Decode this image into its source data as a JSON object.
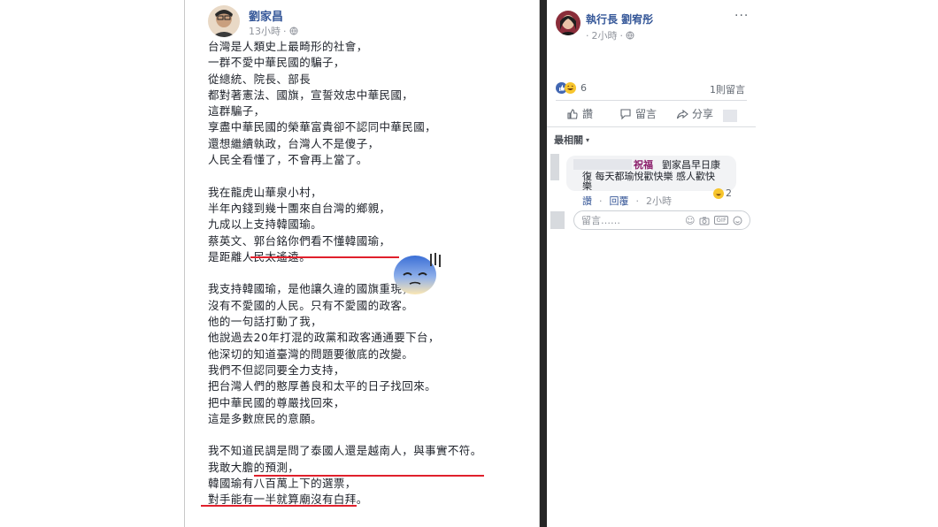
{
  "post": {
    "author": "劉家昌",
    "time": "13小時",
    "paragraphs": [
      [
        "台灣是人類史上最畸形的社會，",
        "一群不愛中華民國的騙子，",
        "從總統、院長、部長",
        "都對著憲法、國旗，宣誓效忠中華民國，",
        "這群騙子，",
        "享盡中華民國的榮華富貴卻不認同中華民國，",
        "還想繼續執政，台灣人不是傻子，",
        "人民全看懂了，不會再上當了。"
      ],
      [
        "我在龍虎山華泉小村，",
        "半年內錢到幾十團來自台灣的鄉親，",
        "九成以上支持韓國瑜。",
        "蔡英文、郭台銘你們看不懂韓國瑜，",
        "是距離人民太遙遠。"
      ],
      [
        "我支持韓國瑜，是他讓久違的國旗重現，",
        "沒有不愛國的人民。只有不愛國的政客。",
        "他的一句話打動了我，",
        "他說過去20年打混的政黨和政客通通要下台，",
        "他深切的知道臺灣的問題要徹底的改變。",
        "我們不但認同要全力支持，",
        "把台灣人們的憨厚善良和太平的日子找回來。",
        "把中華民國的尊嚴找回來，",
        "這是多數庶民的意願。"
      ],
      [
        "我不知道民調是問了泰國人還是越南人，與事實不符。",
        "我敢大膽的預測，",
        "韓國瑜有八百萬上下的選票，",
        "對手能有一半就算廟沒有白拜。"
      ]
    ]
  },
  "side": {
    "author": "執行長 劉宥彤",
    "time": "2小時",
    "reaction_count": "6",
    "comment_count": "1則留言",
    "actions": {
      "like": "讚",
      "comment": "留言",
      "share": "分享"
    },
    "sort_label": "最相關",
    "comment": {
      "tag": "祝福",
      "text_line1": "劉家昌早日康",
      "text_line2": "復 每天都瑜悅歡快樂 感人歡快",
      "text_line3": "樂",
      "reaction_count": "2",
      "like": "讚",
      "reply": "回覆",
      "time": "2小時"
    },
    "input_placeholder": "留言……"
  },
  "colors": {
    "link": "#365899",
    "underline": "#e0202c",
    "meta": "#90949c"
  }
}
